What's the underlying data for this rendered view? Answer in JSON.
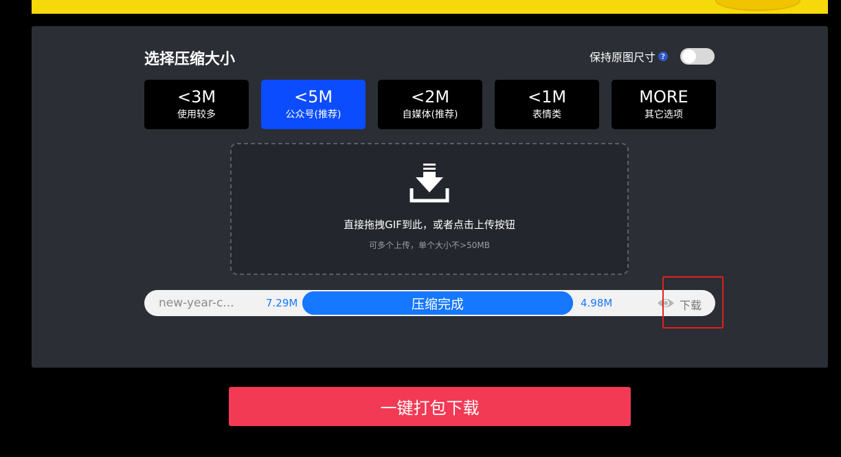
{
  "colors": {
    "page_bg": "#000000",
    "banner": "#f5d90a",
    "panel_bg": "#2b2e35",
    "active_option": "#0b4cff",
    "progress": "#1677ff",
    "bulk_button": "#f23a55",
    "highlight": "#e0201e"
  },
  "compress": {
    "title": "选择压缩大小",
    "keep_size_label": "保持原图尺寸",
    "help_icon": "?",
    "keep_size_enabled": false,
    "options": [
      {
        "size": "<3M",
        "desc": "使用较多",
        "active": false
      },
      {
        "size": "<5M",
        "desc": "公众号(推荐)",
        "active": true
      },
      {
        "size": "<2M",
        "desc": "自媒体(推荐)",
        "active": false
      },
      {
        "size": "<1M",
        "desc": "表情类",
        "active": false
      },
      {
        "size": "MORE",
        "desc": "其它选项",
        "active": false
      }
    ]
  },
  "upload": {
    "icon": "download-tray-icon",
    "main_text": "直接拖拽GIF到此，或者点击上传按钮",
    "sub_text": "可多个上传，单个大小不>50MB"
  },
  "file": {
    "name": "new-year-c...",
    "original_size": "7.29M",
    "status": "压缩完成",
    "progress": 1.0,
    "compressed_size": "4.98M",
    "preview_icon": "eye-icon",
    "download_label": "下载"
  },
  "bulk_download_label": "一键打包下载"
}
